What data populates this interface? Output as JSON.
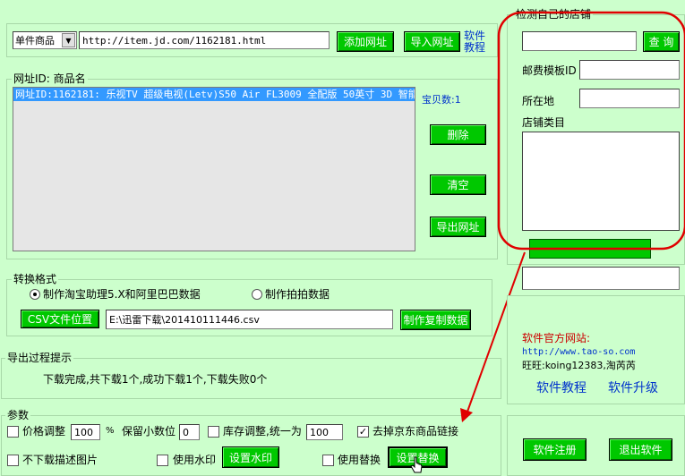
{
  "top": {
    "product_type": "单件商品",
    "url_value": "http://item.jd.com/1162181.html",
    "add_url_label": "添加网址",
    "import_url_label": "导入网址",
    "tutorial_line1": "软件",
    "tutorial_line2": "教程"
  },
  "list_panel": {
    "legend": "网址ID: 商品名",
    "items": [
      "网址ID:1162181: 乐视TV 超级电视(Letv)S50 Air FL3009 全配版 50英寸 3D 智能"
    ],
    "count_label": "宝贝数:1",
    "delete_label": "删除",
    "clear_label": "清空",
    "export_label": "导出网址"
  },
  "convert": {
    "legend": "转换格式",
    "radio1_label": "制作淘宝助理5.X和阿里巴巴数据",
    "radio2_label": "制作拍拍数据",
    "csv_location_label": "CSV文件位置",
    "csv_path": "E:\\迅雷下载\\201410111446.csv",
    "make_copy_label": "制作复制数据"
  },
  "progress": {
    "legend": "导出过程提示",
    "message": "下载完成,共下载1个,成功下载1个,下载失败0个"
  },
  "params": {
    "legend": "参数",
    "price_adjust_label": "价格调整",
    "price_value": "100",
    "percent": "%",
    "decimal_label": "保留小数位",
    "decimal_value": "0",
    "stock_adjust_label": "库存调整,统一为",
    "stock_value": "100",
    "remove_jd_label": "去掉京东商品链接",
    "no_desc_img_label": "不下载描述图片",
    "use_watermark_label": "使用水印",
    "set_watermark_label": "设置水印",
    "use_replace_label": "使用替换",
    "set_replace_label": "设置替换"
  },
  "shop": {
    "legend": "检测自己的店铺",
    "query_label": "查 询",
    "shipping_template_label": "邮费模板ID",
    "location_label": "所在地",
    "category_label": "店铺类目"
  },
  "info": {
    "site_label": "软件官方网站:",
    "site_url": "http://www.tao-so.com",
    "wangwang": "旺旺:koing12383,淘芮芮",
    "tutorial_link": "软件教程",
    "upgrade_link": "软件升级"
  },
  "footer": {
    "register_label": "软件注册",
    "exit_label": "退出软件"
  },
  "colors": {
    "background": "#ccffcc",
    "button_green": "#00c800",
    "highlight_blue": "#3399ff",
    "annotation_red": "#e00000"
  }
}
